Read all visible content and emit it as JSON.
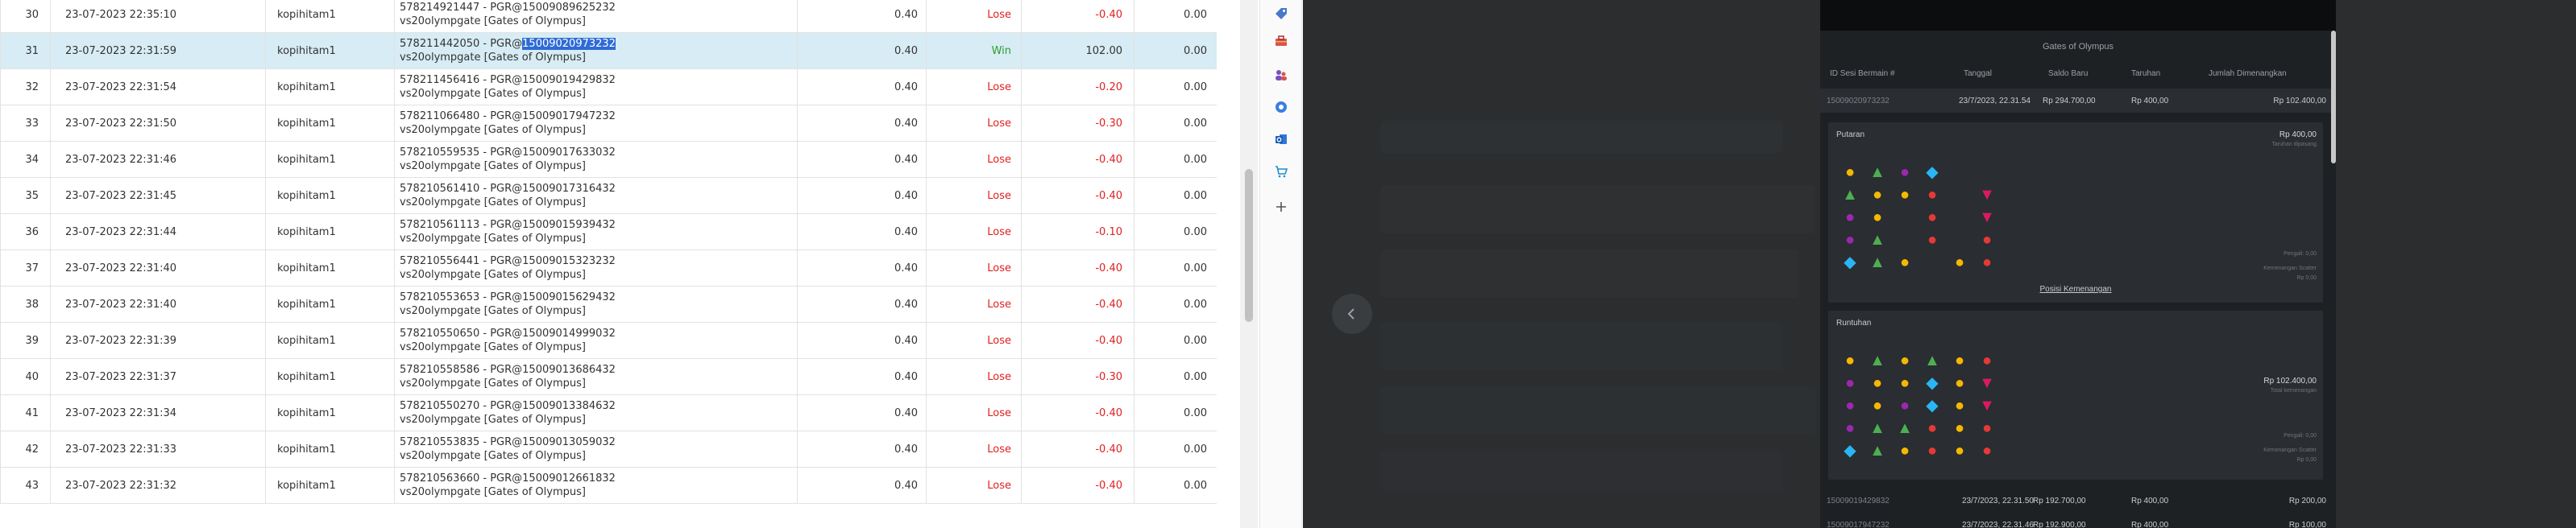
{
  "table": {
    "rows": [
      {
        "no": "30",
        "date": "23-07-2023 22:35:10",
        "user": "kopihitam1",
        "game_line1": "578214921447 - PGR@15009089625232",
        "game_line2": "vs20olympgate [Gates of Olympus]",
        "bet": "0.40",
        "result": "Lose",
        "winloss": "-0.40",
        "balance": "0.00"
      },
      {
        "no": "31",
        "date": "23-07-2023 22:31:59",
        "user": "kopihitam1",
        "game_line1_prefix": "578211442050 - PGR@",
        "game_line1_selected": "15009020973232",
        "game_line2": "vs20olympgate [Gates of Olympus]",
        "bet": "0.40",
        "result": "Win",
        "winloss": "102.00",
        "balance": "0.00"
      },
      {
        "no": "32",
        "date": "23-07-2023 22:31:54",
        "user": "kopihitam1",
        "game_line1": "578211456416 - PGR@15009019429832",
        "game_line2": "vs20olympgate [Gates of Olympus]",
        "bet": "0.40",
        "result": "Lose",
        "winloss": "-0.20",
        "balance": "0.00"
      },
      {
        "no": "33",
        "date": "23-07-2023 22:31:50",
        "user": "kopihitam1",
        "game_line1": "578211066480 - PGR@15009017947232",
        "game_line2": "vs20olympgate [Gates of Olympus]",
        "bet": "0.40",
        "result": "Lose",
        "winloss": "-0.30",
        "balance": "0.00"
      },
      {
        "no": "34",
        "date": "23-07-2023 22:31:46",
        "user": "kopihitam1",
        "game_line1": "578210559535 - PGR@15009017633032",
        "game_line2": "vs20olympgate [Gates of Olympus]",
        "bet": "0.40",
        "result": "Lose",
        "winloss": "-0.40",
        "balance": "0.00"
      },
      {
        "no": "35",
        "date": "23-07-2023 22:31:45",
        "user": "kopihitam1",
        "game_line1": "578210561410 - PGR@15009017316432",
        "game_line2": "vs20olympgate [Gates of Olympus]",
        "bet": "0.40",
        "result": "Lose",
        "winloss": "-0.40",
        "balance": "0.00"
      },
      {
        "no": "36",
        "date": "23-07-2023 22:31:44",
        "user": "kopihitam1",
        "game_line1": "578210561113 - PGR@15009015939432",
        "game_line2": "vs20olympgate [Gates of Olympus]",
        "bet": "0.40",
        "result": "Lose",
        "winloss": "-0.10",
        "balance": "0.00"
      },
      {
        "no": "37",
        "date": "23-07-2023 22:31:40",
        "user": "kopihitam1",
        "game_line1": "578210556441 - PGR@15009015323232",
        "game_line2": "vs20olympgate [Gates of Olympus]",
        "bet": "0.40",
        "result": "Lose",
        "winloss": "-0.40",
        "balance": "0.00"
      },
      {
        "no": "38",
        "date": "23-07-2023 22:31:40",
        "user": "kopihitam1",
        "game_line1": "578210553653 - PGR@15009015629432",
        "game_line2": "vs20olympgate [Gates of Olympus]",
        "bet": "0.40",
        "result": "Lose",
        "winloss": "-0.40",
        "balance": "0.00"
      },
      {
        "no": "39",
        "date": "23-07-2023 22:31:39",
        "user": "kopihitam1",
        "game_line1": "578210550650 - PGR@15009014999032",
        "game_line2": "vs20olympgate [Gates of Olympus]",
        "bet": "0.40",
        "result": "Lose",
        "winloss": "-0.40",
        "balance": "0.00"
      },
      {
        "no": "40",
        "date": "23-07-2023 22:31:37",
        "user": "kopihitam1",
        "game_line1": "578210558586 - PGR@15009013686432",
        "game_line2": "vs20olympgate [Gates of Olympus]",
        "bet": "0.40",
        "result": "Lose",
        "winloss": "-0.30",
        "balance": "0.00"
      },
      {
        "no": "41",
        "date": "23-07-2023 22:31:34",
        "user": "kopihitam1",
        "game_line1": "578210550270 - PGR@15009013384632",
        "game_line2": "vs20olympgate [Gates of Olympus]",
        "bet": "0.40",
        "result": "Lose",
        "winloss": "-0.40",
        "balance": "0.00"
      },
      {
        "no": "42",
        "date": "23-07-2023 22:31:33",
        "user": "kopihitam1",
        "game_line1": "578210553835 - PGR@15009013059032",
        "game_line2": "vs20olympgate [Gates of Olympus]",
        "bet": "0.40",
        "result": "Lose",
        "winloss": "-0.40",
        "balance": "0.00"
      },
      {
        "no": "43",
        "date": "23-07-2023 22:31:32",
        "user": "kopihitam1",
        "game_line1": "578210563660 - PGR@15009012661832",
        "game_line2": "vs20olympgate [Gates of Olympus]",
        "bet": "0.40",
        "result": "Lose",
        "winloss": "-0.40",
        "balance": "0.00"
      }
    ]
  },
  "popup": {
    "title": "Gates of Olympus",
    "headers": {
      "round_id": "ID Sesi Bermain #",
      "date": "Tanggal",
      "balance": "Saldo Baru",
      "bet": "Taruhan",
      "win": "Jumlah Dimenangkan"
    },
    "main_row": {
      "id": "1500902097323​2",
      "date": "23/7/2023, 22.31.54",
      "balance": "Rp 294.700,00",
      "bet": "Rp 400,00",
      "win": "Rp 102.400,00"
    },
    "spin_panel": {
      "title": "Putaran",
      "amount": "Rp 400,00",
      "sub": "Taruhan dipasang",
      "note1": "Pengali: 0,00",
      "note2": "Kemenangan Scatter",
      "note3": "Rp 0,00",
      "link": "Posisi Kemenangan"
    },
    "tumble_panel": {
      "title": "Runtuhan",
      "amount": "Rp 102.400,00",
      "sub": "Total kemenangan",
      "note1": "Pengali: 0,00",
      "note2": "Kemenangan Scatter",
      "note3": "Rp 0,00"
    },
    "lower_rows": [
      {
        "id": "15009019429832",
        "date": "23/7/2023, 22.31.50",
        "balance": "Rp 192.700,00",
        "bet": "Rp 400,00",
        "win": "Rp 200,00"
      },
      {
        "id": "15009017947232",
        "date": "23/7/2023, 22.31.46",
        "balance": "Rp 192.900,00",
        "bet": "Rp 400,00",
        "win": "Rp 100,00"
      }
    ]
  },
  "icons": {
    "side": [
      "tag-icon",
      "toolbox-icon",
      "people-icon",
      "circle-app-icon",
      "outlook-icon",
      "cart-icon",
      "plus-icon"
    ],
    "viewer": [
      "chevron-left-icon"
    ]
  },
  "colors": {
    "lose": "#e02020",
    "win": "#2e9d2e",
    "selected_row": "#d7ecf4",
    "selection": "#2f6bd6",
    "viewer_bg": "#2b2d2f"
  }
}
